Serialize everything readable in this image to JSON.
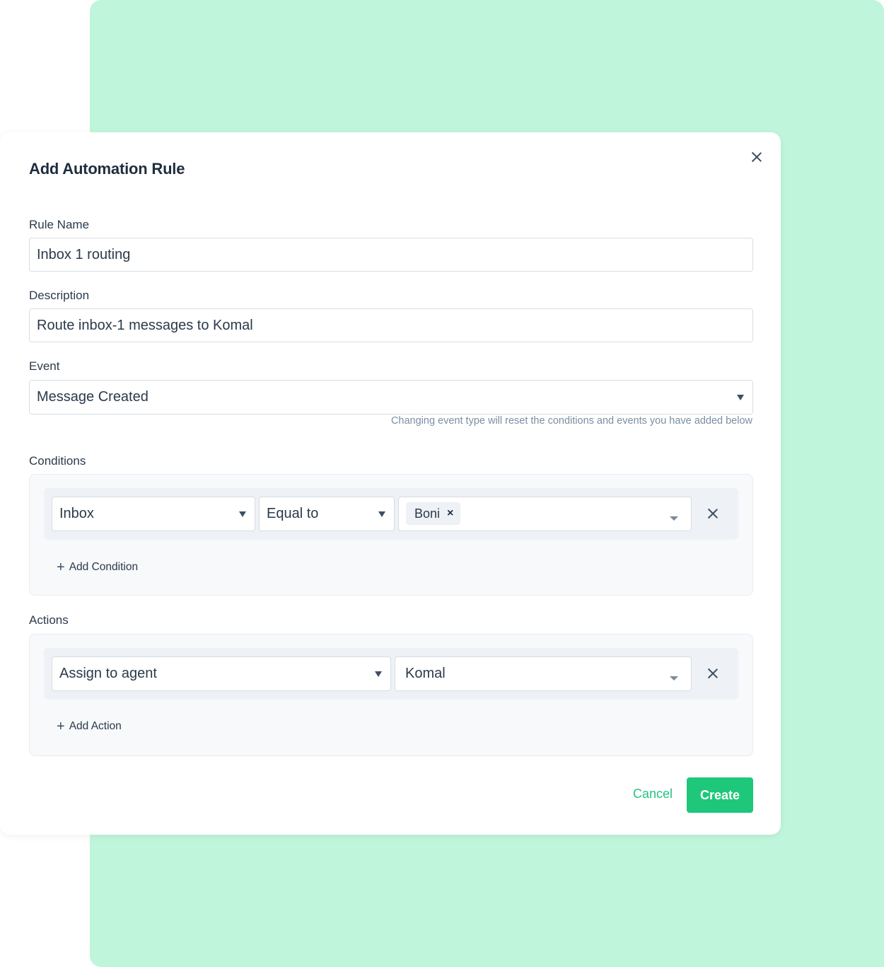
{
  "modal": {
    "title": "Add Automation Rule",
    "rule_name": {
      "label": "Rule Name",
      "value": "Inbox 1 routing"
    },
    "description": {
      "label": "Description",
      "value": "Route inbox-1 messages to Komal"
    },
    "event": {
      "label": "Event",
      "selected": "Message Created",
      "hint": "Changing event type will reset the conditions and events you have added below"
    },
    "conditions": {
      "label": "Conditions",
      "rows": [
        {
          "attribute": "Inbox",
          "operator": "Equal to",
          "values": [
            "Boni"
          ]
        }
      ],
      "add_label": "Add Condition"
    },
    "actions": {
      "label": "Actions",
      "rows": [
        {
          "action": "Assign to agent",
          "value": "Komal"
        }
      ],
      "add_label": "Add Action"
    },
    "footer": {
      "cancel_label": "Cancel",
      "create_label": "Create"
    }
  },
  "colors": {
    "accent": "#1fc77a",
    "background_panel": "#bff5da"
  }
}
